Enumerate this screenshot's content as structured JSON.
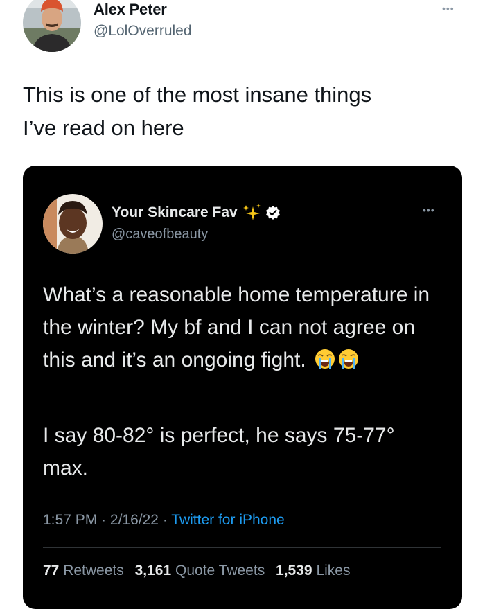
{
  "outer_tweet": {
    "author_name": "Alex Peter",
    "author_handle": "@LolOverruled",
    "more_icon": "more-dots-icon",
    "text": "This is one of the most insane things\nI’ve read on here"
  },
  "quoted_tweet": {
    "author_name": "Your Skincare Fav",
    "author_handle": "@caveofbeauty",
    "name_icons": [
      "sparkles-icon",
      "verified-badge-icon"
    ],
    "more_icon": "more-dots-icon",
    "paragraph1": "What’s a reasonable home temperature in the winter? My bf and I can not agree on this and it’s an ongoing fight.",
    "paragraph1_emojis": [
      "loudly-crying-face-icon",
      "loudly-crying-face-icon"
    ],
    "paragraph2": "I say 80-82° is perfect, he says 75-77° max.",
    "time": "1:57 PM",
    "date": "2/16/22",
    "separator": "·",
    "source": "Twitter for iPhone",
    "retweets_count": "77",
    "retweets_label": "Retweets",
    "quotes_count": "3,161",
    "quotes_label": "Quote Tweets",
    "likes_count": "1,539",
    "likes_label": "Likes"
  },
  "colors": {
    "card_background": "#000000",
    "link_blue": "#1d9bf0",
    "secondary_text": "#8b98a5"
  }
}
